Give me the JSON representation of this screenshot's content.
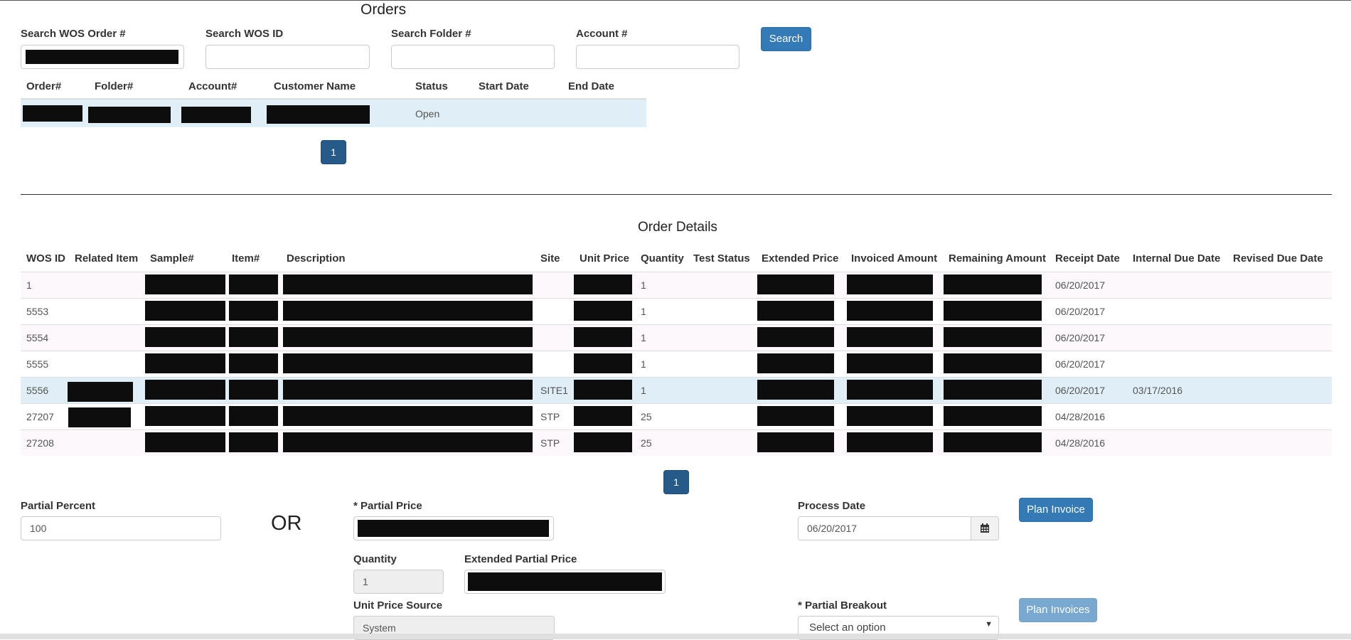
{
  "orders": {
    "title": "Orders",
    "search": {
      "wos_order_label": "Search WOS Order #",
      "wos_id_label": "Search WOS ID",
      "folder_label": "Search Folder #",
      "account_label": "Account #",
      "button": "Search"
    },
    "table": {
      "columns": [
        "Order#",
        "Folder#",
        "Account#",
        "Customer Name",
        "Status",
        "Start Date",
        "End Date"
      ],
      "rows": [
        {
          "order": "[redacted]",
          "folder": "[redacted]",
          "account": "[redacted]",
          "customer": "[redacted]",
          "status": "Open",
          "start": "",
          "end": ""
        }
      ]
    },
    "pagination": {
      "page": "1"
    }
  },
  "order_details": {
    "title": "Order Details",
    "columns": [
      "WOS ID",
      "Related Item",
      "Sample#",
      "Item#",
      "Description",
      "Site",
      "Unit Price",
      "Quantity",
      "Test Status",
      "Extended Price",
      "Invoiced Amount",
      "Remaining Amount",
      "Receipt Date",
      "Internal Due Date",
      "Revised Due Date"
    ],
    "rows": [
      {
        "wos_id": "1",
        "site": "",
        "quantity": "1",
        "receipt": "06/20/2017",
        "internal_due": "",
        "revised_due": ""
      },
      {
        "wos_id": "5553",
        "site": "",
        "quantity": "1",
        "receipt": "06/20/2017",
        "internal_due": "",
        "revised_due": ""
      },
      {
        "wos_id": "5554",
        "site": "",
        "quantity": "1",
        "receipt": "06/20/2017",
        "internal_due": "",
        "revised_due": ""
      },
      {
        "wos_id": "5555",
        "site": "",
        "quantity": "1",
        "receipt": "06/20/2017",
        "internal_due": "",
        "revised_due": ""
      },
      {
        "wos_id": "5556",
        "site": "SITE1",
        "quantity": "1",
        "receipt": "06/20/2017",
        "internal_due": "03/17/2016",
        "revised_due": ""
      },
      {
        "wos_id": "27207",
        "site": "STP",
        "quantity": "25",
        "receipt": "04/28/2016",
        "internal_due": "",
        "revised_due": ""
      },
      {
        "wos_id": "27208",
        "site": "STP",
        "quantity": "25",
        "receipt": "04/28/2016",
        "internal_due": "",
        "revised_due": ""
      }
    ],
    "pagination": {
      "page": "1"
    }
  },
  "invoice_form": {
    "partial_percent_label": "Partial Percent",
    "partial_percent_value": "100",
    "or_text": "OR",
    "partial_price_label": "* Partial Price",
    "quantity_label": "Quantity",
    "quantity_value": "1",
    "extended_partial_price_label": "Extended Partial Price",
    "unit_price_source_label": "Unit Price Source",
    "unit_price_source_value": "System",
    "process_date_label": "Process Date",
    "process_date_value": "06/20/2017",
    "plan_invoice_button": "Plan Invoice",
    "partial_breakout_label": "* Partial Breakout",
    "partial_breakout_selected": "Select an option",
    "plan_invoices_button": "Plan Invoices"
  },
  "icons": {
    "calendar": "calendar-icon",
    "dropdown": "chevron-down-icon"
  },
  "colors": {
    "primary": "#337ab7",
    "row_highlight": "#dfeef7",
    "redaction": "#0d0d0d"
  }
}
